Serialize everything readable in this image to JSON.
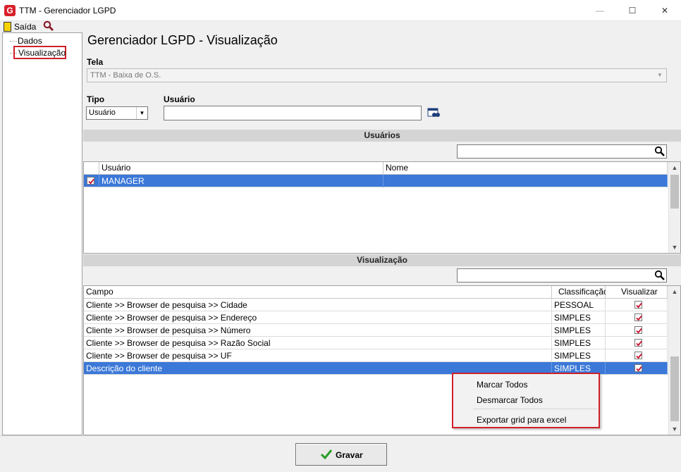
{
  "window": {
    "title": "TTM - Gerenciador LGPD",
    "app_icon": "G"
  },
  "toolbar": {
    "exit_label": "Saída"
  },
  "tree": {
    "items": [
      "Dados",
      "Visualização"
    ]
  },
  "page_title": "Gerenciador LGPD - Visualização",
  "form": {
    "tela_label": "Tela",
    "tela_value": "TTM - Baixa de O.S.",
    "tipo_label": "Tipo",
    "tipo_value": "Usuário",
    "usuario_label": "Usuário",
    "usuario_value": ""
  },
  "usuarios_section": {
    "header": "Usuários",
    "filter_value": "",
    "columns": [
      "Usuário",
      "Nome"
    ],
    "rows": [
      {
        "usuario": "MANAGER",
        "nome": "",
        "checked": true,
        "selected": true
      }
    ]
  },
  "visualizacao_section": {
    "header": "Visualização",
    "filter_value": "",
    "columns": [
      "Campo",
      "Classificação",
      "Visualizar"
    ],
    "rows": [
      {
        "campo": "Cliente >> Browser de pesquisa >> Cidade",
        "classificacao": "PESSOAL",
        "visualizar": true,
        "selected": false
      },
      {
        "campo": "Cliente >> Browser de pesquisa >> Endereço",
        "classificacao": "SIMPLES",
        "visualizar": true,
        "selected": false
      },
      {
        "campo": "Cliente >> Browser de pesquisa >> Número",
        "classificacao": "SIMPLES",
        "visualizar": true,
        "selected": false
      },
      {
        "campo": "Cliente >> Browser de pesquisa >> Razão Social",
        "classificacao": "SIMPLES",
        "visualizar": true,
        "selected": false
      },
      {
        "campo": "Cliente >> Browser de pesquisa >> UF",
        "classificacao": "SIMPLES",
        "visualizar": true,
        "selected": false
      },
      {
        "campo": "Descrição do cliente",
        "classificacao": "SIMPLES",
        "visualizar": true,
        "selected": true
      }
    ]
  },
  "context_menu": {
    "items": [
      "Marcar Todos",
      "Desmarcar Todos",
      "Exportar grid para excel"
    ]
  },
  "actions": {
    "gravar_label": "Gravar"
  },
  "colors": {
    "selection": "#3b78d8",
    "highlight_border": "#d0202a",
    "check": "#c8102e"
  }
}
